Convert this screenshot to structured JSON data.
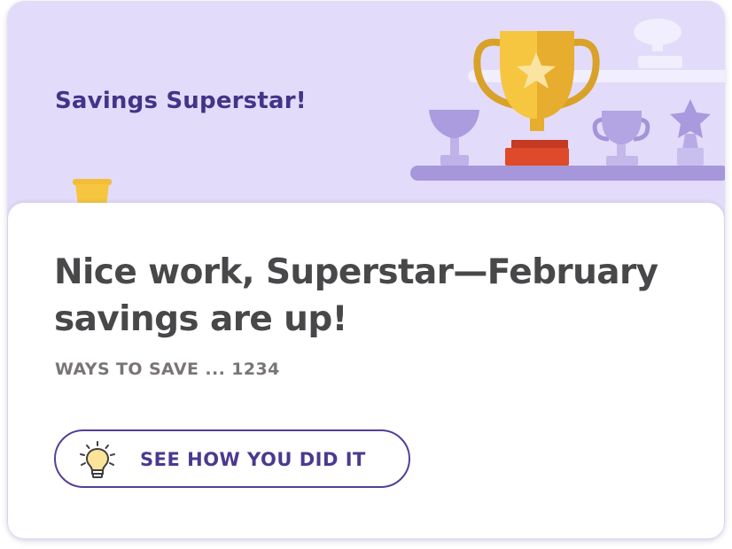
{
  "hero": {
    "title": "Savings Superstar!",
    "illustration": "trophy-shelf-illustration",
    "background_color": "#e2dcfa",
    "accent_color": "#433489"
  },
  "panel": {
    "headline": "Nice work, Superstar—February savings are up!",
    "account_label": "WAYS TO SAVE ... 1234"
  },
  "cta": {
    "label": "SEE HOW YOU DID IT",
    "icon": "lightbulb-icon",
    "border_color": "#553f98"
  },
  "icons": {
    "trophy": "trophy-icon",
    "cup": "cup-trophy-icon",
    "star_trophy": "star-trophy-icon",
    "bowl": "bowl-trophy-icon"
  }
}
